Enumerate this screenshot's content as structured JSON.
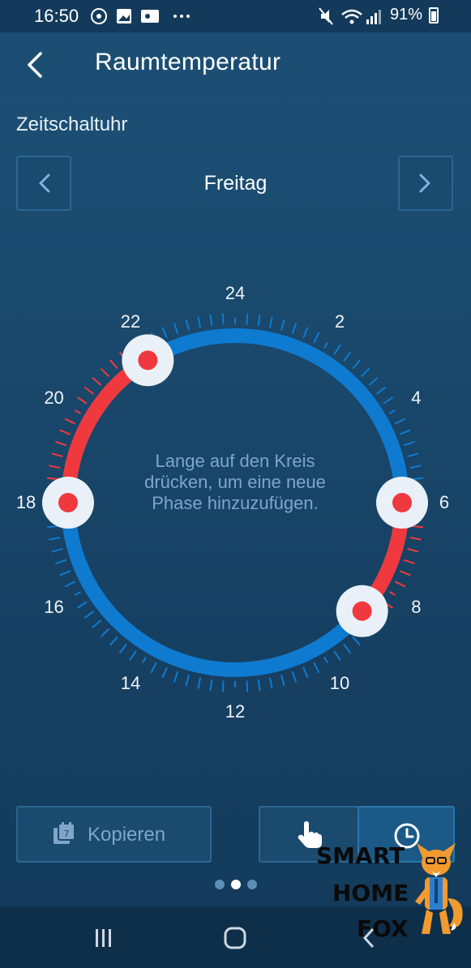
{
  "status_bar": {
    "time": "16:50",
    "battery": "91%",
    "left_icons": [
      "whatsapp-icon",
      "gallery-icon",
      "notification-icon",
      "more-icon"
    ],
    "right_icons": [
      "mute-icon",
      "wifi-icon",
      "signal-icon",
      "battery-icon"
    ]
  },
  "app_bar": {
    "title": "Raumtemperatur",
    "back_icon": "back-arrow-icon"
  },
  "schedule": {
    "section_label": "Zeitschaltuhr",
    "day": "Freitag",
    "hour_labels": [
      "24",
      "2",
      "4",
      "6",
      "8",
      "10",
      "12",
      "14",
      "16",
      "18",
      "20",
      "22"
    ],
    "hint": "Lange auf den Kreis drücken, um eine neue Phase hinzuzufügen.",
    "phases": [
      {
        "start_hour": 6.0,
        "end_hour": 8.7,
        "mode": "heat"
      },
      {
        "start_hour": 18.0,
        "end_hour": 21.9,
        "mode": "heat"
      }
    ],
    "handle_hours": [
      6.0,
      8.7,
      18.0,
      21.9
    ],
    "colors": {
      "heat": "#f0393e",
      "eco": "#0f7bd0",
      "handle": "#e9f0f7",
      "handle_dot": "#f0393e"
    }
  },
  "actions": {
    "copy_label": "Kopieren",
    "copy_icon": "calendar-copy-icon",
    "manual_icon": "hand-pointer-icon",
    "timer_icon": "clock-icon"
  },
  "pager": {
    "count": 3,
    "active": 1
  },
  "watermark": {
    "lines": [
      "SMART",
      "HOME",
      "FOX"
    ]
  },
  "nav": {
    "items": [
      "recents-icon",
      "home-icon",
      "back-icon"
    ]
  }
}
